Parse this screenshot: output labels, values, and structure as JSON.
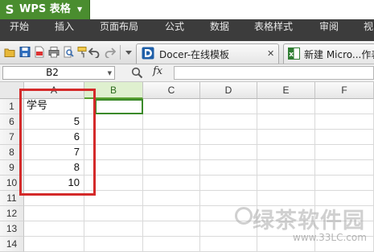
{
  "app": {
    "logo": "S",
    "title": "WPS 表格",
    "dropdown_icon": "caret-down-icon"
  },
  "ribbon": {
    "tabs": [
      "开始",
      "插入",
      "页面布局",
      "公式",
      "数据",
      "表格样式",
      "审阅",
      "视"
    ]
  },
  "doc_tabs": [
    {
      "label": "Docer-在线模板",
      "close": "✕"
    },
    {
      "label": "新建 Micro...作表"
    }
  ],
  "formula_bar": {
    "cell_ref": "B2",
    "fx": "fx",
    "content": ""
  },
  "grid": {
    "columns": [
      "A",
      "B",
      "C",
      "D",
      "E",
      "F"
    ],
    "selected_column": "B",
    "rows": [
      {
        "num": "1",
        "a": "学号"
      },
      {
        "num": "6",
        "a": "5"
      },
      {
        "num": "7",
        "a": "6"
      },
      {
        "num": "8",
        "a": "7"
      },
      {
        "num": "9",
        "a": "8"
      },
      {
        "num": "10",
        "a": "10"
      },
      {
        "num": "11",
        "a": ""
      },
      {
        "num": "12",
        "a": ""
      },
      {
        "num": "13",
        "a": ""
      },
      {
        "num": "14",
        "a": ""
      }
    ]
  },
  "watermark": {
    "brand": "绿茶软件园",
    "url": "www.33LC.com"
  },
  "colors": {
    "app_green": "#4a8d2f",
    "ribbon_bg": "#3c3c3c",
    "highlight_red": "#d42a2a",
    "selection_green": "#3b8a2a"
  }
}
